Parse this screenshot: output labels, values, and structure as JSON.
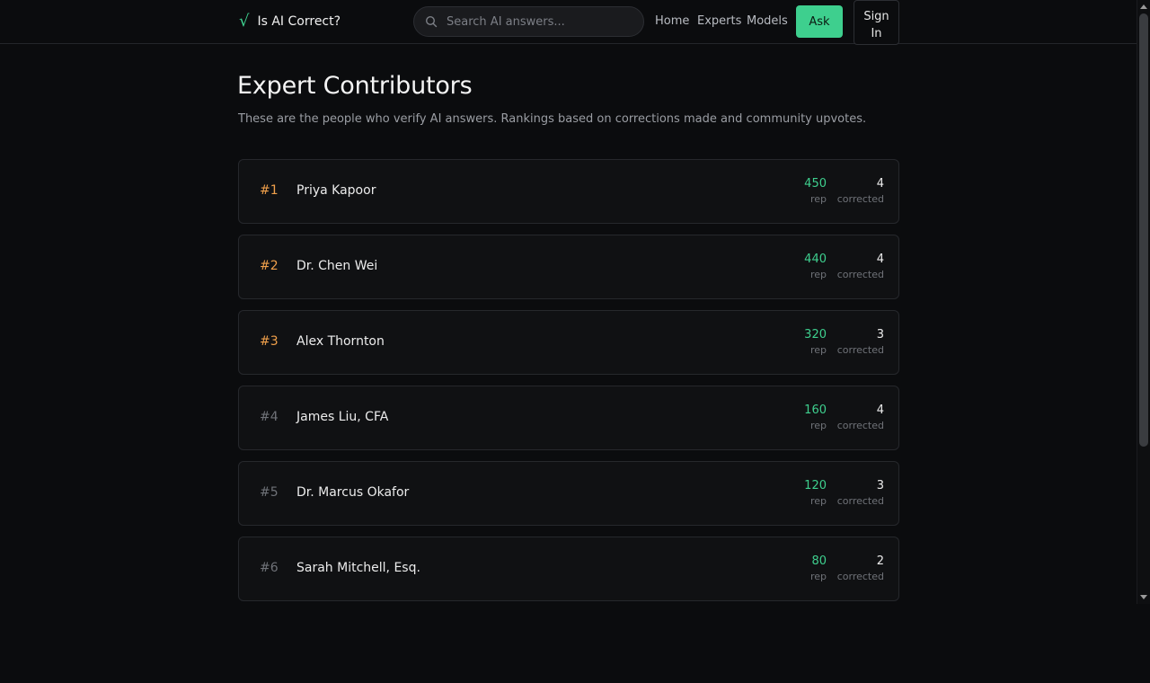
{
  "header": {
    "logo_mark": "√",
    "brand": "Is AI Correct?",
    "search_placeholder": "Search AI answers...",
    "nav": [
      {
        "label": "Home"
      },
      {
        "label": "Experts"
      },
      {
        "label": "Models"
      }
    ],
    "ask_label": "Ask",
    "signin_label": "Sign In"
  },
  "main": {
    "title": "Expert Contributors",
    "subtitle": "These are the people who verify AI answers. Rankings based on corrections made and community upvotes."
  },
  "experts": [
    {
      "rank": "#1",
      "name": "Priya Kapoor",
      "rep": "450",
      "rep_label": "rep",
      "corrected": "4",
      "corrected_label": "corrected"
    },
    {
      "rank": "#2",
      "name": "Dr. Chen Wei",
      "rep": "440",
      "rep_label": "rep",
      "corrected": "4",
      "corrected_label": "corrected"
    },
    {
      "rank": "#3",
      "name": "Alex Thornton",
      "rep": "320",
      "rep_label": "rep",
      "corrected": "3",
      "corrected_label": "corrected"
    },
    {
      "rank": "#4",
      "name": "James Liu, CFA",
      "rep": "160",
      "rep_label": "rep",
      "corrected": "4",
      "corrected_label": "corrected"
    },
    {
      "rank": "#5",
      "name": "Dr. Marcus Okafor",
      "rep": "120",
      "rep_label": "rep",
      "corrected": "3",
      "corrected_label": "corrected"
    },
    {
      "rank": "#6",
      "name": "Sarah Mitchell, Esq.",
      "rep": "80",
      "rep_label": "rep",
      "corrected": "2",
      "corrected_label": "corrected"
    }
  ],
  "colors": {
    "accent": "#3ecf8e",
    "top_rank": "#f0a04b",
    "background": "#0b0c0e"
  }
}
